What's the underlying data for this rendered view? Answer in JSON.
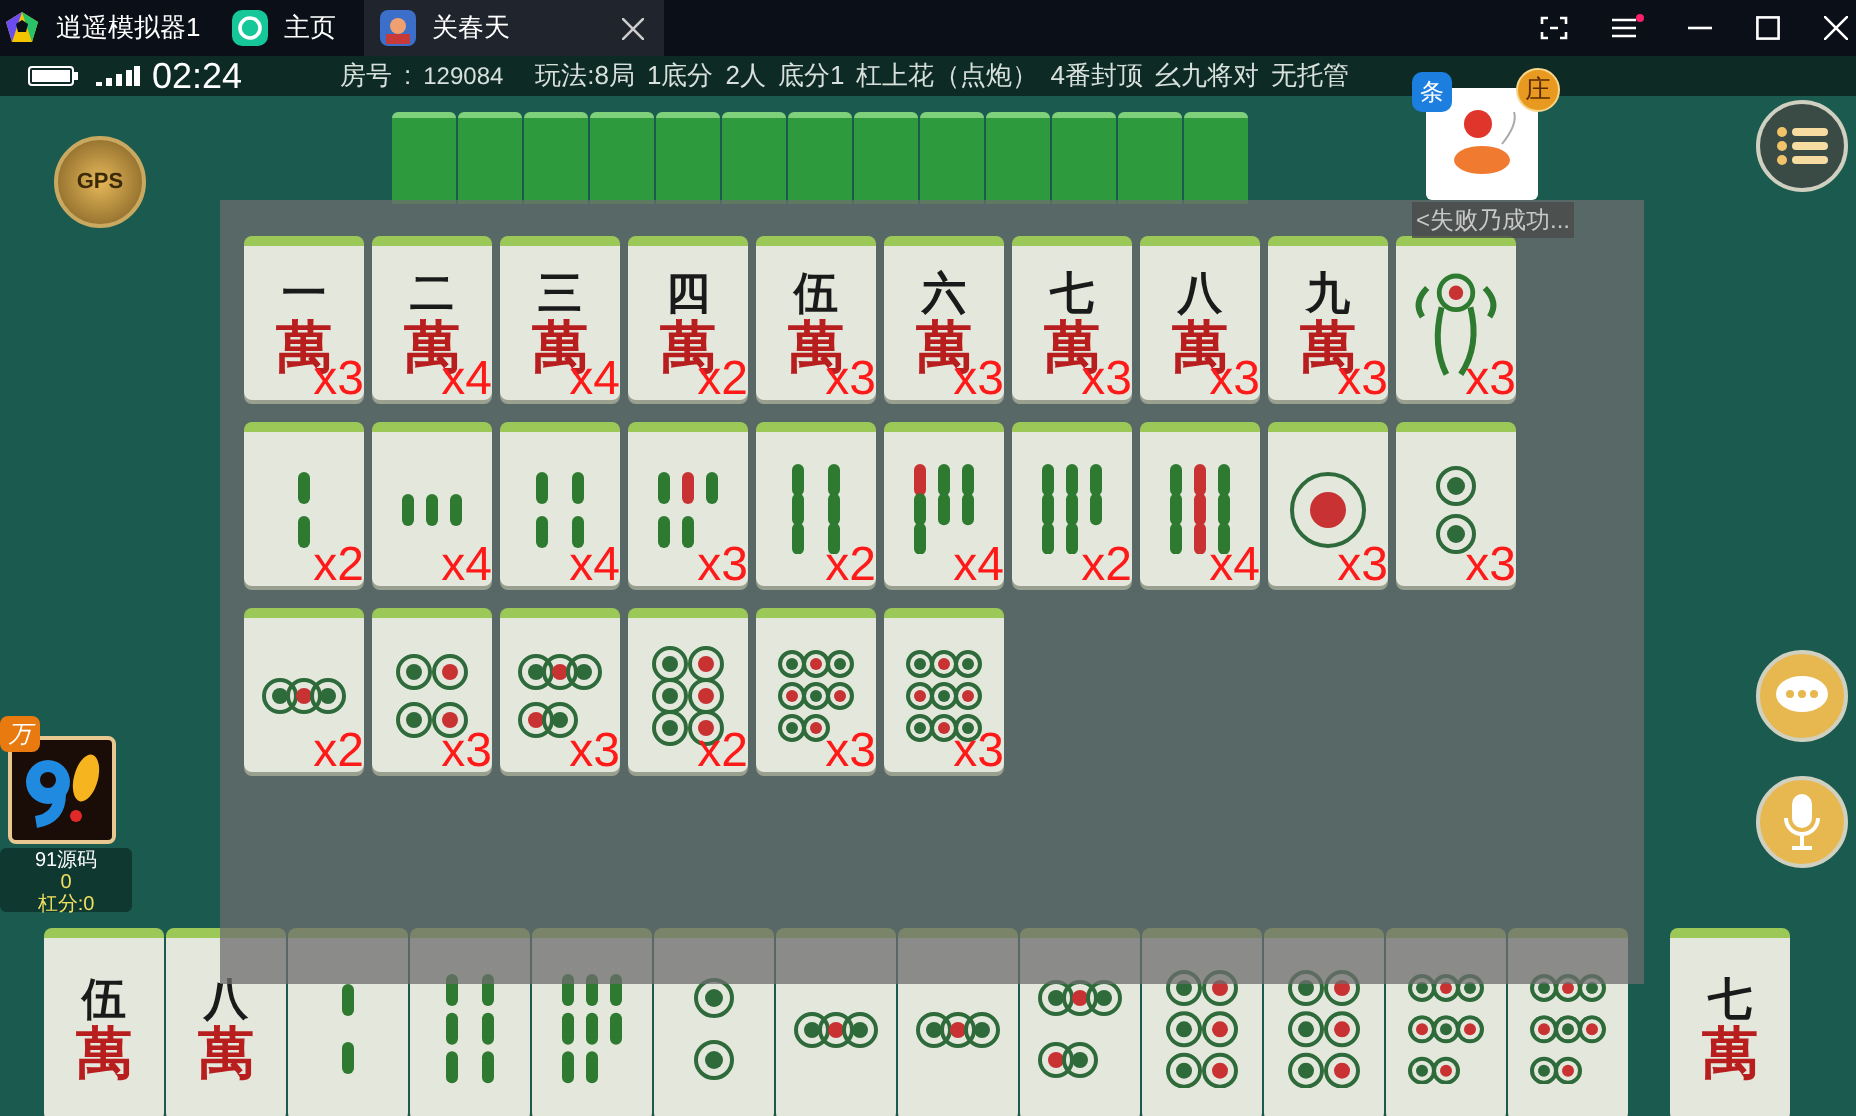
{
  "app_tabs": [
    {
      "title": "逍遥模拟器1",
      "selected": false,
      "kind": "app"
    },
    {
      "title": "主页",
      "selected": false,
      "kind": "home"
    },
    {
      "title": "关春天",
      "selected": true,
      "kind": "game"
    }
  ],
  "status_bar": {
    "time": "02:24",
    "room_label": "房号",
    "room_separator": ":",
    "room_number": "129084",
    "rules": [
      "玩法:8局",
      "1底分",
      "2人",
      "底分1",
      "杠上花（点炮）",
      "4番封顶",
      "幺九将对",
      "无托管"
    ]
  },
  "gps_button": "GPS",
  "opponent": {
    "suit_badge": "条",
    "dealer_badge": "庄",
    "name": "<失败乃成功..."
  },
  "remaining_tiles": [
    {
      "kind": "wan",
      "numeral": "一",
      "suit_char": "萬",
      "count": "x3"
    },
    {
      "kind": "wan",
      "numeral": "二",
      "suit_char": "萬",
      "count": "x4"
    },
    {
      "kind": "wan",
      "numeral": "三",
      "suit_char": "萬",
      "count": "x4"
    },
    {
      "kind": "wan",
      "numeral": "四",
      "suit_char": "萬",
      "count": "x2"
    },
    {
      "kind": "wan",
      "numeral": "伍",
      "suit_char": "萬",
      "count": "x3"
    },
    {
      "kind": "wan",
      "numeral": "六",
      "suit_char": "萬",
      "count": "x3"
    },
    {
      "kind": "wan",
      "numeral": "七",
      "suit_char": "萬",
      "count": "x3"
    },
    {
      "kind": "wan",
      "numeral": "八",
      "suit_char": "萬",
      "count": "x3"
    },
    {
      "kind": "wan",
      "numeral": "九",
      "suit_char": "萬",
      "count": "x3"
    },
    {
      "kind": "bird",
      "count": "x3"
    },
    {
      "kind": "bamboo2",
      "count": "x2"
    },
    {
      "kind": "bamboo3",
      "count": "x4"
    },
    {
      "kind": "bamboo4",
      "count": "x4"
    },
    {
      "kind": "bamboo5",
      "count": "x3"
    },
    {
      "kind": "bamboo6",
      "count": "x2"
    },
    {
      "kind": "bamboo7",
      "count": "x4"
    },
    {
      "kind": "bamboo8",
      "count": "x2"
    },
    {
      "kind": "bamboo9",
      "count": "x4"
    },
    {
      "kind": "circle1",
      "count": "x3"
    },
    {
      "kind": "circle2",
      "count": "x3"
    },
    {
      "kind": "circle3",
      "count": "x2"
    },
    {
      "kind": "circle4",
      "count": "x3"
    },
    {
      "kind": "circle5",
      "count": "x3"
    },
    {
      "kind": "circle6",
      "count": "x2"
    },
    {
      "kind": "circle8",
      "count": "x3"
    },
    {
      "kind": "circle9",
      "count": "x3"
    }
  ],
  "player": {
    "avatar_badge": "万",
    "name": "91源码",
    "score": "0",
    "gang_score": "杠分:0"
  },
  "hand": [
    {
      "kind": "wan",
      "numeral": "伍",
      "suit_char": "萬"
    },
    {
      "kind": "wan",
      "numeral": "八",
      "suit_char": "萬"
    },
    {
      "kind": "bamboo2"
    },
    {
      "kind": "bamboo6"
    },
    {
      "kind": "bamboo8"
    },
    {
      "kind": "circle2"
    },
    {
      "kind": "circle3"
    },
    {
      "kind": "circle3"
    },
    {
      "kind": "circle5"
    },
    {
      "kind": "circle6"
    },
    {
      "kind": "circle6"
    },
    {
      "kind": "circle8"
    },
    {
      "kind": "circle8"
    }
  ],
  "drawn_tile": {
    "kind": "wan",
    "numeral": "七",
    "suit_char": "萬"
  }
}
